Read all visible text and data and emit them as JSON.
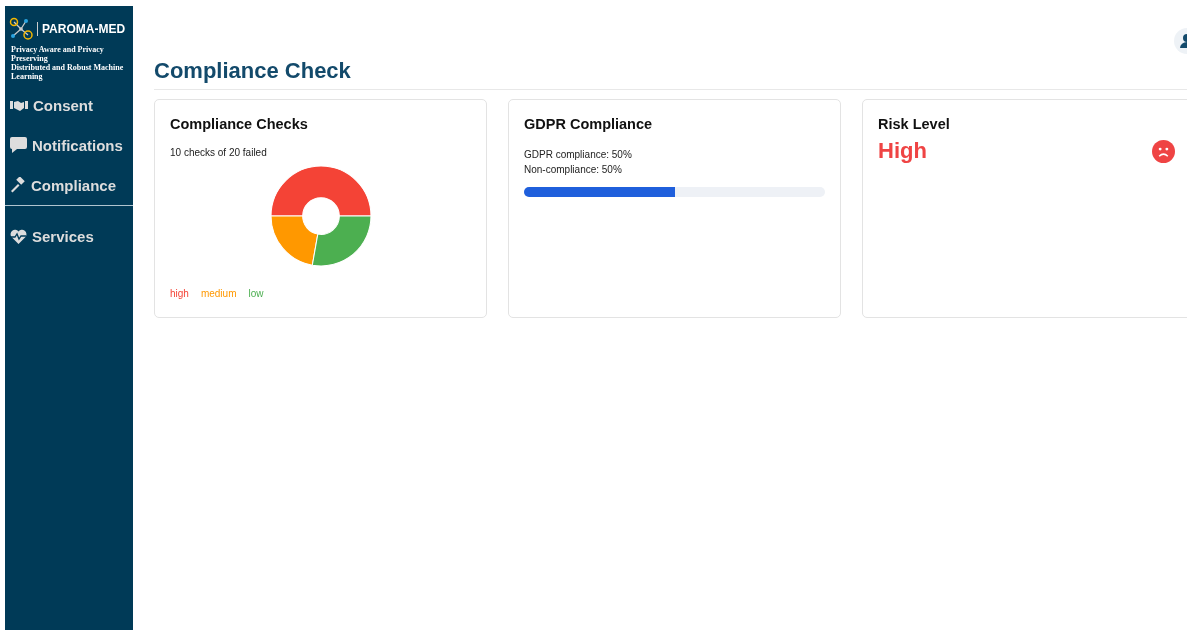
{
  "brand": {
    "name": "PAROMA-MED",
    "tagline_lines": [
      "Privacy Aware and Privacy Preserving",
      "Distributed and Robust Machine Learning"
    ]
  },
  "sidebar": {
    "items": [
      {
        "label": "Consent",
        "kind": "handshake"
      },
      {
        "label": "Notifications",
        "kind": "comment"
      },
      {
        "label": "Compliance",
        "kind": "gavel"
      }
    ],
    "secondary_items": [
      {
        "label": "Services",
        "kind": "heartbeat"
      }
    ]
  },
  "page": {
    "title": "Compliance Check"
  },
  "cards": [
    {
      "kind": "donut",
      "title": "Compliance Checks",
      "summary": "10 checks of 20 failed",
      "legend": [
        {
          "label": "high",
          "color": "#f44336"
        },
        {
          "label": "medium",
          "color": "#ff9800"
        },
        {
          "label": "low",
          "color": "#4caf50"
        }
      ]
    },
    {
      "kind": "progress",
      "title": "GDPR Compliance",
      "lines": [
        "GDPR compliance: 50%",
        "Non-compliance: 50%"
      ],
      "level": 0.5
    },
    {
      "kind": "risk",
      "title": "Risk Level",
      "value": "High"
    }
  ]
}
